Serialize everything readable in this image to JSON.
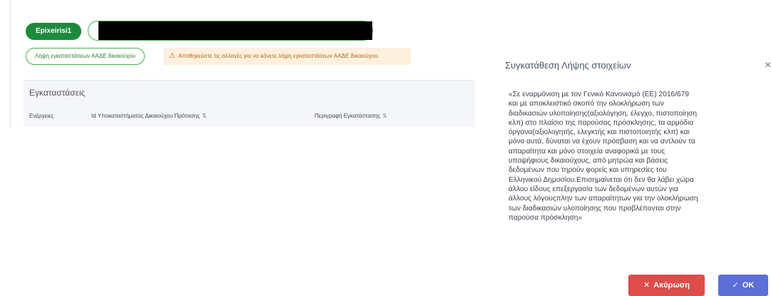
{
  "background": {
    "chip_label": "Epixeirisi1",
    "fetch_button_label": "Λήψη εγκαταστάσεων ΑΑΔΕ δικαιούχου",
    "warning_icon": "warning-triangle-icon",
    "warning_text": "Αποθηκεύστε τις αλλαγές για να κάνετε λήψη εγκαταστάσεων ΑΑΔΕ δικαιούχου.",
    "section_title": "Εγκαταστάσεις",
    "columns": [
      "Ενέργειες",
      "Id Υποκαταστήματος Δικαιούχου Πρότασης",
      "Περιγραφή Εγκατάστασης"
    ]
  },
  "dialog": {
    "title": "Συγκατάθεση Λήψης στοιχείων",
    "close_symbol": "×",
    "body": "«Σε εναρμόνιση με τον Γενικό Κανονισμό (ΕΕ) 2016/679\nκαι με αποκλειστικό σκοπό την ολοκλήρωση των\nδιαδικασιών υλοποίησης(αξιολόγηση, έλεγχο, πιστοποίηση\nκλπ) στο πλαίσιο της παρούσας πρόσκλησης, τα αρμόδια\nόργανα(αξιολογητής, ελεγκτής και πιστοποιητής κλπ) και\nμόνο αυτά, δύναται να έχουν πρόσβαση και να αντλούν τα\nαπαραίτητα και μόνο στοιχεία αναφορικά με τους\nυποψήφιους δικαιούχους, από μητρώα και βάσεις\nδεδομένων που τηρούν φορείς και υπηρεσίες του\nΕλληνικού Δημοσίου.Επισημαίνεται ότι δεν θα λάβει χώρα\nάλλου είδους επεξεργασία των δεδομένων αυτών για\nάλλους λόγουςπλην των απαραίτητων για την ολοκλήρωση\nτων διαδικασιών υλοποίησης που προβλέπονται στην\nπαρούσα πρόσκληση»",
    "cancel_label": "Ακύρωση",
    "ok_label": "OK"
  },
  "colors": {
    "green": "#1c8a3c",
    "cancel_red": "#e04b4b",
    "ok_blue": "#5b6fd6",
    "warning_bg": "#fdf0df"
  }
}
